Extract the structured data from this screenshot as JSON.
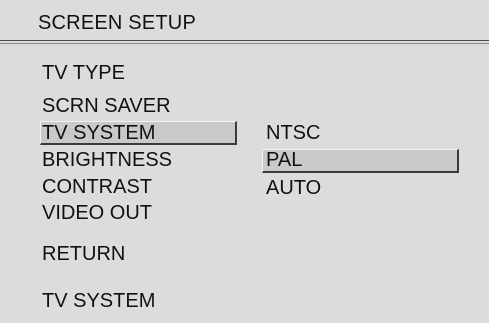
{
  "header": {
    "title": "SCREEN SETUP"
  },
  "menu": {
    "items": [
      {
        "label": "TV TYPE",
        "selected": false
      },
      {
        "label": "SCRN SAVER",
        "selected": false
      },
      {
        "label": "TV SYSTEM",
        "selected": true
      },
      {
        "label": "BRIGHTNESS",
        "selected": false
      },
      {
        "label": "CONTRAST",
        "selected": false
      },
      {
        "label": "VIDEO OUT",
        "selected": false
      },
      {
        "label": "RETURN",
        "selected": false
      }
    ]
  },
  "submenu": {
    "options": [
      {
        "label": "NTSC",
        "selected": false
      },
      {
        "label": "PAL",
        "selected": true
      },
      {
        "label": "AUTO",
        "selected": false
      }
    ]
  },
  "status": {
    "text": "TV SYSTEM"
  },
  "colors": {
    "background": "#dcdcdc",
    "highlight": "#c9c9c9",
    "text": "#111111",
    "rule": "#4a4a4a"
  }
}
